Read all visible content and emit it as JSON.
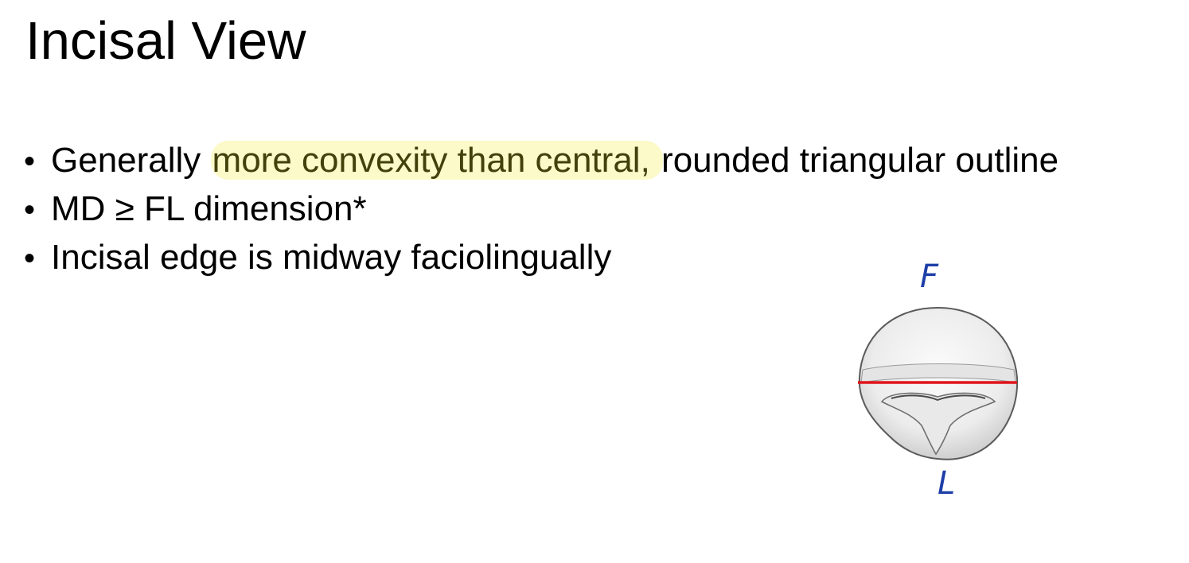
{
  "slide": {
    "title": "Incisal View",
    "bullets": [
      {
        "prefix": "Generally ",
        "highlight": "more convexity than central,",
        "suffix": " rounded triangular outline"
      },
      {
        "text": "MD ≥ FL dimension*"
      },
      {
        "text": "Incisal edge is midway faciolingually"
      }
    ]
  },
  "figure": {
    "label_top": "F",
    "label_bottom": "L",
    "line_color": "#e0141b",
    "label_color": "#1e3fa8",
    "highlight_color": "#fbfac8"
  }
}
